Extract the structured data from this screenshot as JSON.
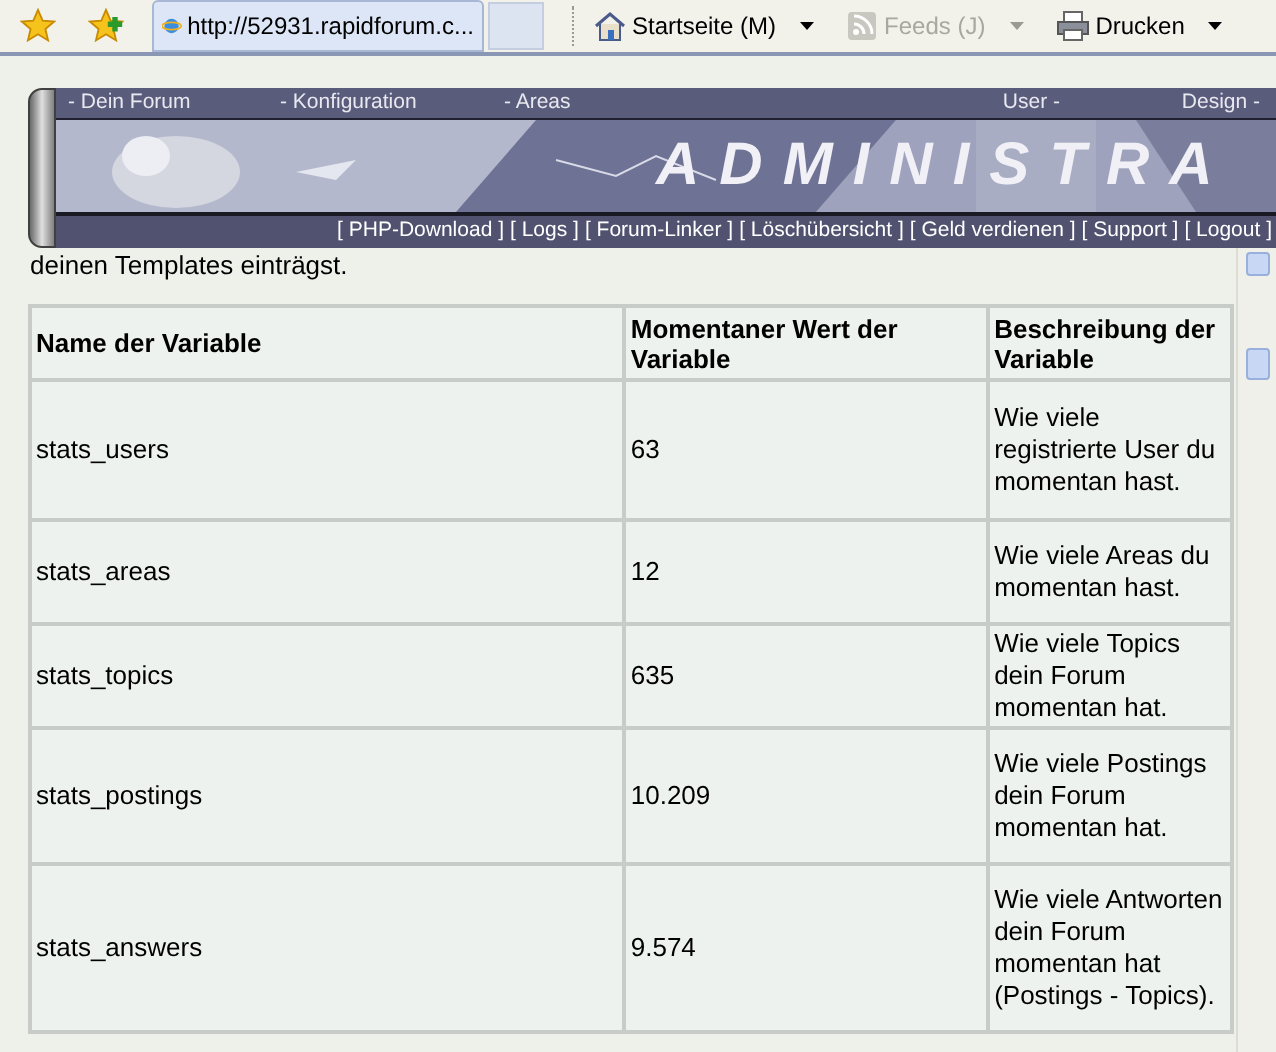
{
  "toolbar": {
    "tab": {
      "title": "http://52931.rapidforum.c...",
      "selected": true
    },
    "commands": [
      {
        "label": "Startseite (M)",
        "kind": "home",
        "disabled": false,
        "dropdown": true
      },
      {
        "label": "Feeds (J)",
        "kind": "feed",
        "disabled": true,
        "dropdown": true
      },
      {
        "label": "Drucken",
        "kind": "print",
        "disabled": false,
        "dropdown": true
      }
    ]
  },
  "header": {
    "nav": [
      "- Dein Forum",
      "- Konfiguration",
      "- Areas",
      "User -",
      "Design -"
    ],
    "banner_title": "ADMINISTRA",
    "links": [
      "[ PHP-Download ]",
      "[ Logs ]",
      "[ Forum-Linker ]",
      "[ Löschübersicht ]",
      "[ Geld verdienen ]",
      "[ Support ]",
      "[ Logout ]"
    ]
  },
  "intro": "deinen Templates einträgst.",
  "table": {
    "columns": [
      "Name der Variable",
      "Momentaner Wert der Variable",
      "Beschreibung der Variable"
    ],
    "rows": [
      {
        "name": "stats_users",
        "value": "63",
        "description": "Wie viele registrierte User du momentan hast."
      },
      {
        "name": "stats_areas",
        "value": "12",
        "description": "Wie viele Areas du momentan hast."
      },
      {
        "name": "stats_topics",
        "value": "635",
        "description": "Wie viele Topics dein Forum momentan hat."
      },
      {
        "name": "stats_postings",
        "value": "10.209",
        "description": "Wie viele Postings dein Forum momentan hat."
      },
      {
        "name": "stats_answers",
        "value": "9.574",
        "description": "Wie viele Antworten dein Forum momentan hat (Postings - Topics)."
      }
    ]
  }
}
